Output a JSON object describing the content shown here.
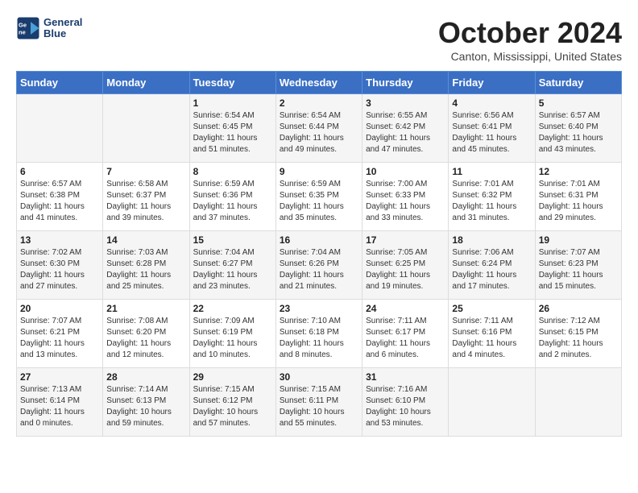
{
  "header": {
    "logo_line1": "General",
    "logo_line2": "Blue",
    "month_title": "October 2024",
    "location": "Canton, Mississippi, United States"
  },
  "weekdays": [
    "Sunday",
    "Monday",
    "Tuesday",
    "Wednesday",
    "Thursday",
    "Friday",
    "Saturday"
  ],
  "weeks": [
    [
      {
        "day": "",
        "sunrise": "",
        "sunset": "",
        "daylight": ""
      },
      {
        "day": "",
        "sunrise": "",
        "sunset": "",
        "daylight": ""
      },
      {
        "day": "1",
        "sunrise": "Sunrise: 6:54 AM",
        "sunset": "Sunset: 6:45 PM",
        "daylight": "Daylight: 11 hours and 51 minutes."
      },
      {
        "day": "2",
        "sunrise": "Sunrise: 6:54 AM",
        "sunset": "Sunset: 6:44 PM",
        "daylight": "Daylight: 11 hours and 49 minutes."
      },
      {
        "day": "3",
        "sunrise": "Sunrise: 6:55 AM",
        "sunset": "Sunset: 6:42 PM",
        "daylight": "Daylight: 11 hours and 47 minutes."
      },
      {
        "day": "4",
        "sunrise": "Sunrise: 6:56 AM",
        "sunset": "Sunset: 6:41 PM",
        "daylight": "Daylight: 11 hours and 45 minutes."
      },
      {
        "day": "5",
        "sunrise": "Sunrise: 6:57 AM",
        "sunset": "Sunset: 6:40 PM",
        "daylight": "Daylight: 11 hours and 43 minutes."
      }
    ],
    [
      {
        "day": "6",
        "sunrise": "Sunrise: 6:57 AM",
        "sunset": "Sunset: 6:38 PM",
        "daylight": "Daylight: 11 hours and 41 minutes."
      },
      {
        "day": "7",
        "sunrise": "Sunrise: 6:58 AM",
        "sunset": "Sunset: 6:37 PM",
        "daylight": "Daylight: 11 hours and 39 minutes."
      },
      {
        "day": "8",
        "sunrise": "Sunrise: 6:59 AM",
        "sunset": "Sunset: 6:36 PM",
        "daylight": "Daylight: 11 hours and 37 minutes."
      },
      {
        "day": "9",
        "sunrise": "Sunrise: 6:59 AM",
        "sunset": "Sunset: 6:35 PM",
        "daylight": "Daylight: 11 hours and 35 minutes."
      },
      {
        "day": "10",
        "sunrise": "Sunrise: 7:00 AM",
        "sunset": "Sunset: 6:33 PM",
        "daylight": "Daylight: 11 hours and 33 minutes."
      },
      {
        "day": "11",
        "sunrise": "Sunrise: 7:01 AM",
        "sunset": "Sunset: 6:32 PM",
        "daylight": "Daylight: 11 hours and 31 minutes."
      },
      {
        "day": "12",
        "sunrise": "Sunrise: 7:01 AM",
        "sunset": "Sunset: 6:31 PM",
        "daylight": "Daylight: 11 hours and 29 minutes."
      }
    ],
    [
      {
        "day": "13",
        "sunrise": "Sunrise: 7:02 AM",
        "sunset": "Sunset: 6:30 PM",
        "daylight": "Daylight: 11 hours and 27 minutes."
      },
      {
        "day": "14",
        "sunrise": "Sunrise: 7:03 AM",
        "sunset": "Sunset: 6:28 PM",
        "daylight": "Daylight: 11 hours and 25 minutes."
      },
      {
        "day": "15",
        "sunrise": "Sunrise: 7:04 AM",
        "sunset": "Sunset: 6:27 PM",
        "daylight": "Daylight: 11 hours and 23 minutes."
      },
      {
        "day": "16",
        "sunrise": "Sunrise: 7:04 AM",
        "sunset": "Sunset: 6:26 PM",
        "daylight": "Daylight: 11 hours and 21 minutes."
      },
      {
        "day": "17",
        "sunrise": "Sunrise: 7:05 AM",
        "sunset": "Sunset: 6:25 PM",
        "daylight": "Daylight: 11 hours and 19 minutes."
      },
      {
        "day": "18",
        "sunrise": "Sunrise: 7:06 AM",
        "sunset": "Sunset: 6:24 PM",
        "daylight": "Daylight: 11 hours and 17 minutes."
      },
      {
        "day": "19",
        "sunrise": "Sunrise: 7:07 AM",
        "sunset": "Sunset: 6:23 PM",
        "daylight": "Daylight: 11 hours and 15 minutes."
      }
    ],
    [
      {
        "day": "20",
        "sunrise": "Sunrise: 7:07 AM",
        "sunset": "Sunset: 6:21 PM",
        "daylight": "Daylight: 11 hours and 13 minutes."
      },
      {
        "day": "21",
        "sunrise": "Sunrise: 7:08 AM",
        "sunset": "Sunset: 6:20 PM",
        "daylight": "Daylight: 11 hours and 12 minutes."
      },
      {
        "day": "22",
        "sunrise": "Sunrise: 7:09 AM",
        "sunset": "Sunset: 6:19 PM",
        "daylight": "Daylight: 11 hours and 10 minutes."
      },
      {
        "day": "23",
        "sunrise": "Sunrise: 7:10 AM",
        "sunset": "Sunset: 6:18 PM",
        "daylight": "Daylight: 11 hours and 8 minutes."
      },
      {
        "day": "24",
        "sunrise": "Sunrise: 7:11 AM",
        "sunset": "Sunset: 6:17 PM",
        "daylight": "Daylight: 11 hours and 6 minutes."
      },
      {
        "day": "25",
        "sunrise": "Sunrise: 7:11 AM",
        "sunset": "Sunset: 6:16 PM",
        "daylight": "Daylight: 11 hours and 4 minutes."
      },
      {
        "day": "26",
        "sunrise": "Sunrise: 7:12 AM",
        "sunset": "Sunset: 6:15 PM",
        "daylight": "Daylight: 11 hours and 2 minutes."
      }
    ],
    [
      {
        "day": "27",
        "sunrise": "Sunrise: 7:13 AM",
        "sunset": "Sunset: 6:14 PM",
        "daylight": "Daylight: 11 hours and 0 minutes."
      },
      {
        "day": "28",
        "sunrise": "Sunrise: 7:14 AM",
        "sunset": "Sunset: 6:13 PM",
        "daylight": "Daylight: 10 hours and 59 minutes."
      },
      {
        "day": "29",
        "sunrise": "Sunrise: 7:15 AM",
        "sunset": "Sunset: 6:12 PM",
        "daylight": "Daylight: 10 hours and 57 minutes."
      },
      {
        "day": "30",
        "sunrise": "Sunrise: 7:15 AM",
        "sunset": "Sunset: 6:11 PM",
        "daylight": "Daylight: 10 hours and 55 minutes."
      },
      {
        "day": "31",
        "sunrise": "Sunrise: 7:16 AM",
        "sunset": "Sunset: 6:10 PM",
        "daylight": "Daylight: 10 hours and 53 minutes."
      },
      {
        "day": "",
        "sunrise": "",
        "sunset": "",
        "daylight": ""
      },
      {
        "day": "",
        "sunrise": "",
        "sunset": "",
        "daylight": ""
      }
    ]
  ]
}
